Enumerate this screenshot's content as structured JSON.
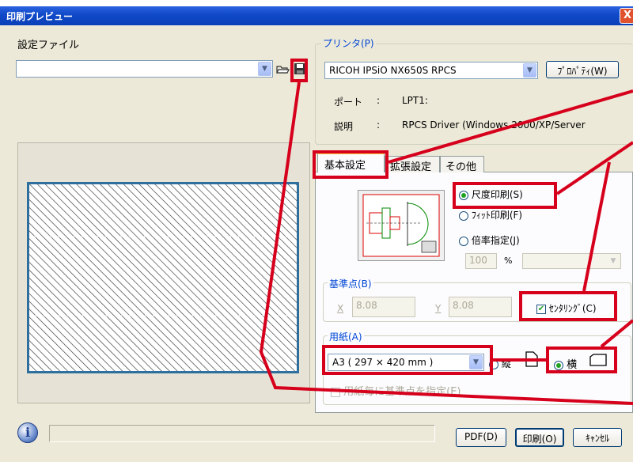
{
  "window": {
    "title": "印刷プレビュー",
    "close_glyph": "X"
  },
  "settings_file": {
    "label": "設定ファイル",
    "value": ""
  },
  "printer": {
    "group_label": "プリンタ(P)",
    "name": "RICOH IPSiO NX650S RPCS",
    "properties_button": "ﾌﾟﾛﾊﾟﾃｨ(W)",
    "port_label": "ポート",
    "port_value": "LPT1:",
    "desc_label": "説明",
    "desc_value": "RPCS Driver (Windows 2000/XP/Server",
    "colon": ":"
  },
  "tabs": [
    {
      "label": "基本設定",
      "active": true
    },
    {
      "label": "拡張設定",
      "active": false
    },
    {
      "label": "その他",
      "active": false
    }
  ],
  "scale": {
    "options": [
      {
        "label": "尺度印刷(S)",
        "selected": true
      },
      {
        "label": "ﾌｨｯﾄ印刷(F)",
        "selected": false
      },
      {
        "label": "倍率指定(J)",
        "selected": false
      }
    ],
    "percent_value": "100",
    "percent_unit": "%"
  },
  "reference_point": {
    "group_label": "基準点(B)",
    "x_label": "X",
    "x_value": "8.08",
    "y_label": "Y",
    "y_value": "8.08",
    "centering_label": "ｾﾝﾀﾘﾝｸﾞ(C)",
    "centering_checked": true
  },
  "paper": {
    "group_label": "用紙(A)",
    "size_value": "A3 ( 297 × 420 mm )",
    "orientation_portrait": "縦",
    "orientation_landscape": "横",
    "landscape_selected": true,
    "per_sheet_label": "用紙毎に基準点を指定(E)"
  },
  "bottom": {
    "info_icon_glyph": "i",
    "pdf_button": "PDF(D)",
    "print_button": "印刷(O)",
    "cancel_button": "ｷｬﾝｾﾙ"
  },
  "colors": {
    "title_bar": "#0a3fb7",
    "annotation_red": "#d6001c",
    "dialog_bg": "#ece9d8",
    "preview_border": "#2e6f9e"
  }
}
